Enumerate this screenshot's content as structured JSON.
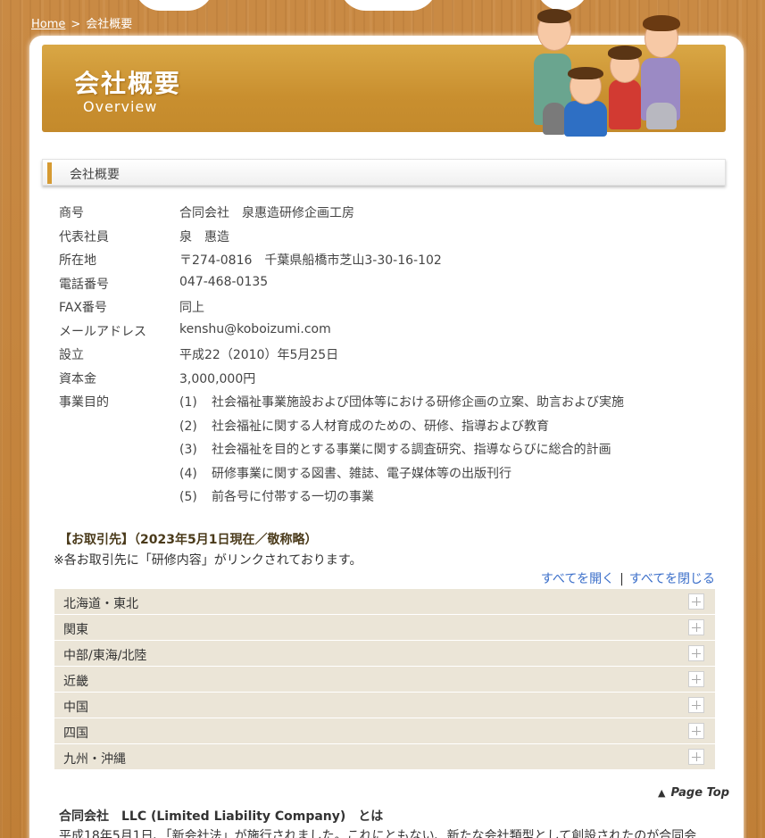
{
  "breadcrumb": {
    "home": "Home",
    "separator": ">",
    "current": "会社概要"
  },
  "banner": {
    "title": "会社概要",
    "subtitle": "Overview"
  },
  "section": {
    "heading": "会社概要"
  },
  "company": {
    "rows": [
      {
        "label": "商号",
        "value": "合同会社　泉惠造研修企画工房"
      },
      {
        "label": "代表社員",
        "value": "泉　惠造"
      },
      {
        "label": "所在地",
        "value": "〒274-0816　千葉県船橋市芝山3-30-16-102"
      },
      {
        "label": "電話番号",
        "value": "047-468-0135"
      },
      {
        "label": "FAX番号",
        "value": "同上"
      },
      {
        "label": "メールアドレス",
        "value": "kenshu@koboizumi.com"
      },
      {
        "label": "設立",
        "value": "平成22（2010）年5月25日"
      },
      {
        "label": "資本金",
        "value": "3,000,000円"
      }
    ],
    "purpose_label": "事業目的",
    "purposes": [
      {
        "num": "(1)",
        "text": "社会福祉事業施設および団体等における研修企画の立案、助言および実施"
      },
      {
        "num": "(2)",
        "text": "社会福祉に関する人材育成のための、研修、指導および教育"
      },
      {
        "num": "(3)",
        "text": "社会福祉を目的とする事業に関する調査研究、指導ならびに総合的計画"
      },
      {
        "num": "(4)",
        "text": "研修事業に関する図書、雑誌、電子媒体等の出版刊行"
      },
      {
        "num": "(5)",
        "text": "前各号に付帯する一切の事業"
      }
    ]
  },
  "clients": {
    "title": "【お取引先】（2023年5月1日現在／敬称略）",
    "note": "※各お取引先に「研修内容」がリンクされております。",
    "open_all": "すべてを開く",
    "close_all": "すべてを閉じる",
    "divider": "|",
    "regions": [
      "北海道・東北",
      "関東",
      "中部/東海/北陸",
      "近畿",
      "中国",
      "四国",
      "九州・沖縄"
    ]
  },
  "page_top": {
    "label": "Page Top",
    "arrow": "▲"
  },
  "llc": {
    "title": "合同会社　LLC (Limited Liability Company)　とは",
    "text": "平成18年5月1日、「新会社法」が施行されました。これにともない、新たな会社類型として創設されたのが合同会"
  },
  "colors": {
    "wood": "#c98a44",
    "banner": "#d9a745",
    "accent_bar": "#d69a32",
    "accordion_bg": "#ebe5d7",
    "link": "#3a6ec9"
  }
}
